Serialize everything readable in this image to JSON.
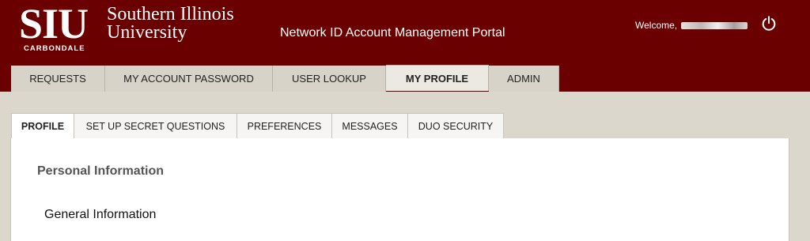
{
  "header": {
    "logo": {
      "siu": "SIU",
      "carbondale": "CARBONDALE",
      "line1": "Southern Illinois",
      "line2": "University"
    },
    "portal_title": "Network ID Account Management Portal",
    "welcome_label": "Welcome, ",
    "power_icon": "power-icon",
    "brand_color": "#6b0000"
  },
  "topnav": {
    "tabs": [
      {
        "label": "REQUESTS",
        "active": false
      },
      {
        "label": "MY ACCOUNT PASSWORD",
        "active": false
      },
      {
        "label": "USER LOOKUP",
        "active": false
      },
      {
        "label": "MY PROFILE",
        "active": true
      },
      {
        "label": "ADMIN",
        "active": false
      }
    ]
  },
  "subnav": {
    "tabs": [
      {
        "label": "PROFILE",
        "active": true
      },
      {
        "label": "SET UP SECRET QUESTIONS",
        "active": false
      },
      {
        "label": "PREFERENCES",
        "active": false
      },
      {
        "label": "MESSAGES",
        "active": false
      },
      {
        "label": "DUO SECURITY",
        "active": false
      }
    ]
  },
  "main": {
    "section_title": "Personal Information",
    "subsection_title": "General Information"
  }
}
